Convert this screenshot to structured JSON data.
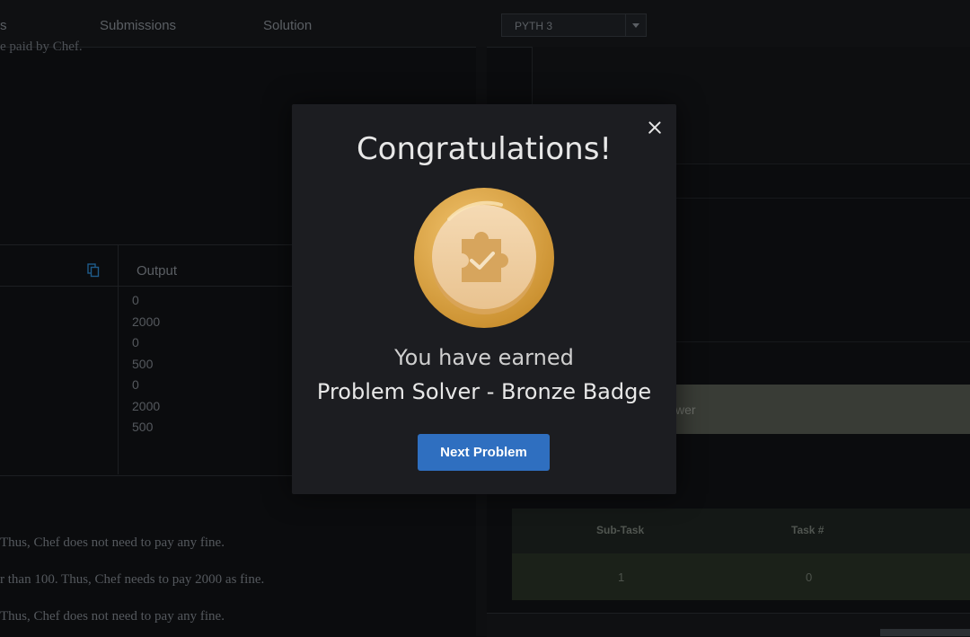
{
  "header": {
    "tabs": [
      {
        "label": "s"
      },
      {
        "label": "Submissions"
      },
      {
        "label": "Solution"
      }
    ],
    "language_select": {
      "value": "PYTH 3"
    }
  },
  "problem": {
    "lead_text": "e paid by Chef.",
    "io": {
      "output_header": "Output",
      "output_lines": [
        "0",
        "2000",
        "0",
        "500",
        "0",
        "2000",
        "500"
      ]
    },
    "explanations": [
      "Thus, Chef does not need to pay any fine.",
      "r than 100. Thus, Chef needs to pay 2000 as fine.",
      "Thus, Chef does not need to pay any fine."
    ]
  },
  "right_panel": {
    "answer_text": "wer",
    "result_table": {
      "headers": [
        "Sub-Task",
        "Task #"
      ],
      "row": [
        "1",
        "0"
      ]
    }
  },
  "modal": {
    "title": "Congratulations!",
    "earned_text": "You have earned",
    "badge_name": "Problem Solver - Bronze Badge",
    "next_button": "Next Problem",
    "badge_icon": "puzzle-check-icon",
    "colors": {
      "background": "#1c1d21",
      "button": "#2f6fc0",
      "medal_outer": "#e0aa4e",
      "medal_inner": "#f0cfa2"
    }
  }
}
